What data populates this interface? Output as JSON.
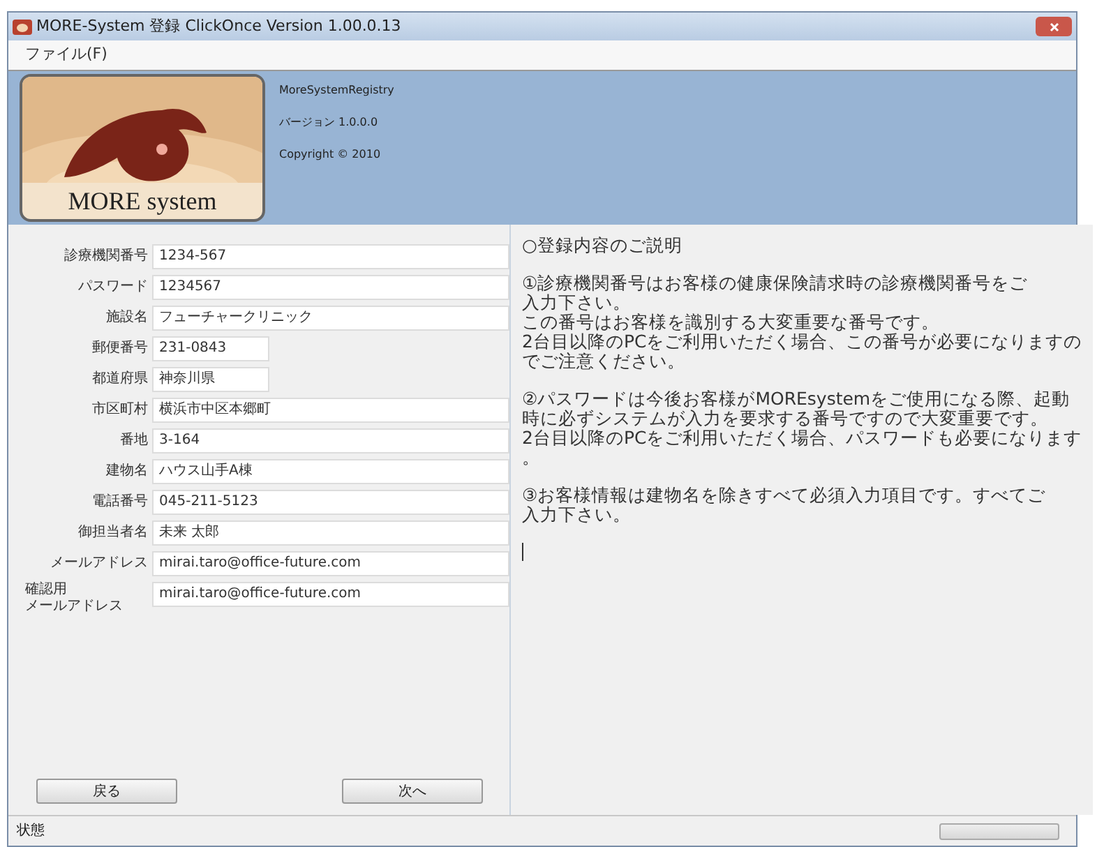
{
  "window": {
    "title": "MORE-System 登録 ClickOnce Version 1.00.0.13"
  },
  "menu": [
    "ファイル(F)"
  ],
  "header": {
    "logo_text": "MORE system",
    "lines": [
      "MoreSystemRegistry",
      "バージョン 1.0.0.0",
      "Copyright ©  2010"
    ]
  },
  "form": {
    "fields": [
      {
        "kind": "wide",
        "label": "診療機関番号",
        "value": "1234-567"
      },
      {
        "kind": "wide",
        "label": "パスワード",
        "value": "1234567"
      },
      {
        "kind": "wide",
        "label": "施設名",
        "value": "フューチャークリニック"
      },
      {
        "kind": "narrow",
        "label": "郵便番号",
        "value": "231-0843"
      },
      {
        "kind": "narrow",
        "label": "都道府県",
        "value": "神奈川県"
      },
      {
        "kind": "wide",
        "label": "市区町村",
        "value": "横浜市中区本郷町"
      },
      {
        "kind": "wide",
        "label": "番地",
        "value": "3-164"
      },
      {
        "kind": "wide",
        "label": "建物名",
        "value": "ハウス山手A棟"
      },
      {
        "kind": "wide",
        "label": "電話番号",
        "value": "045-211-5123"
      },
      {
        "kind": "wide",
        "label": "御担当者名",
        "value": "未来 太郎"
      },
      {
        "kind": "wide",
        "label": "メールアドレス",
        "value": "mirai.taro@office-future.com"
      },
      {
        "kind": "stacked",
        "label_lines": [
          "確認用",
          "メールアドレス"
        ],
        "value": "mirai.taro@office-future.com"
      }
    ],
    "buttons": [
      "戻る",
      "次へ"
    ]
  },
  "explanation": {
    "paragraphs": [
      [
        "○登録内容のご説明"
      ],
      [
        "①診療機関番号はお客様の健康保険請求時の診療機関番号をご",
        "入力下さい。",
        "この番号はお客様を識別する大変重要な番号です。",
        "2台目以降のPCをご利用いただく場合、この番号が必要になりますの",
        "でご注意ください。"
      ],
      [
        "②パスワードは今後お客様がMOREsystemをご使用になる際、起動",
        "時に必ずシステムが入力を要求する番号ですので大変重要です。",
        "2台目以降のPCをご利用いただく場合、パスワードも必要になります",
        "。"
      ],
      [
        "③お客様情報は建物名を除きすべて必須入力項目です。すべてご",
        "入力下さい。"
      ]
    ]
  },
  "status_bar": {
    "text": "状態",
    "progress": {
      "level": 0
    }
  }
}
